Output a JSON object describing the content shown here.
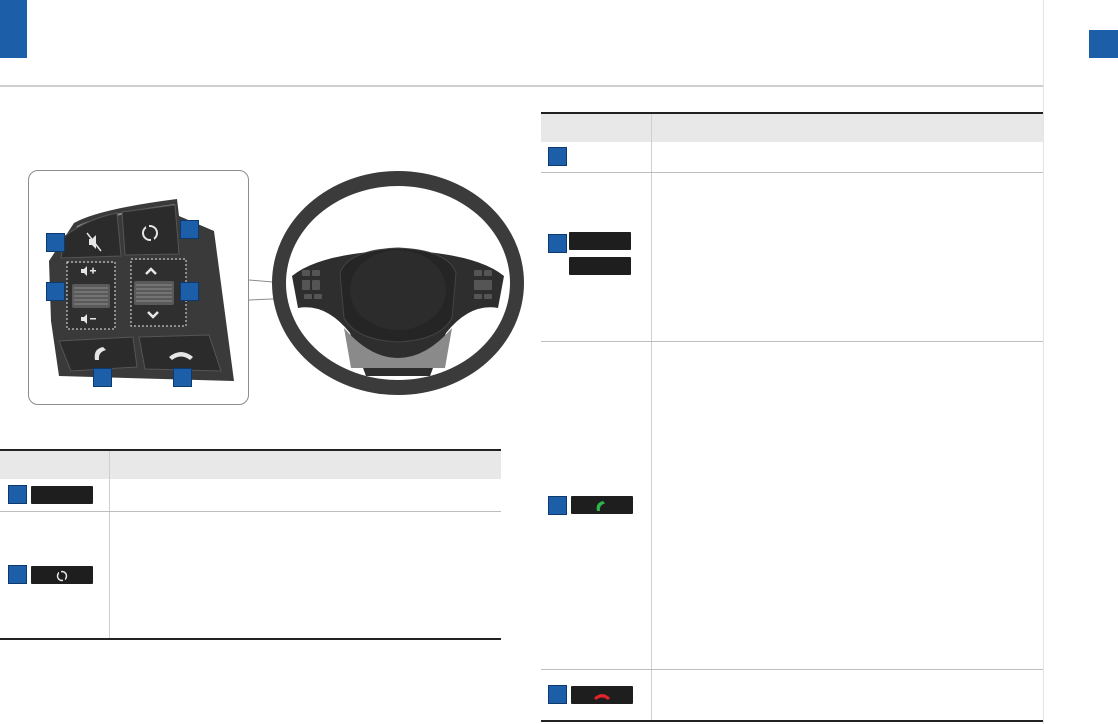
{
  "colors": {
    "accent": "#1c5ea8",
    "key_chip": "#1e1e1e",
    "call_green": "#2fb34a",
    "end_red": "#e0242b"
  },
  "illustration": {
    "icons": [
      "mute-icon",
      "mode-icon",
      "volume-up-icon",
      "volume-down-icon",
      "seek-up-icon",
      "seek-down-icon",
      "call-icon",
      "end-call-icon",
      "steering-wheel-icon"
    ]
  },
  "left_table": {
    "headers": [
      "",
      ""
    ],
    "rows": [
      {
        "key_icon": "blank-key-icon",
        "description": ""
      },
      {
        "key_icon": "mode-icon",
        "description": ""
      }
    ]
  },
  "right_table": {
    "headers": [
      "",
      ""
    ],
    "rows": [
      {
        "key_icon": "none",
        "description": ""
      },
      {
        "key_icon": "blank-key-icon",
        "description": ""
      },
      {
        "key_icon": "call-icon",
        "description": ""
      },
      {
        "key_icon": "end-call-icon",
        "description": ""
      }
    ]
  }
}
